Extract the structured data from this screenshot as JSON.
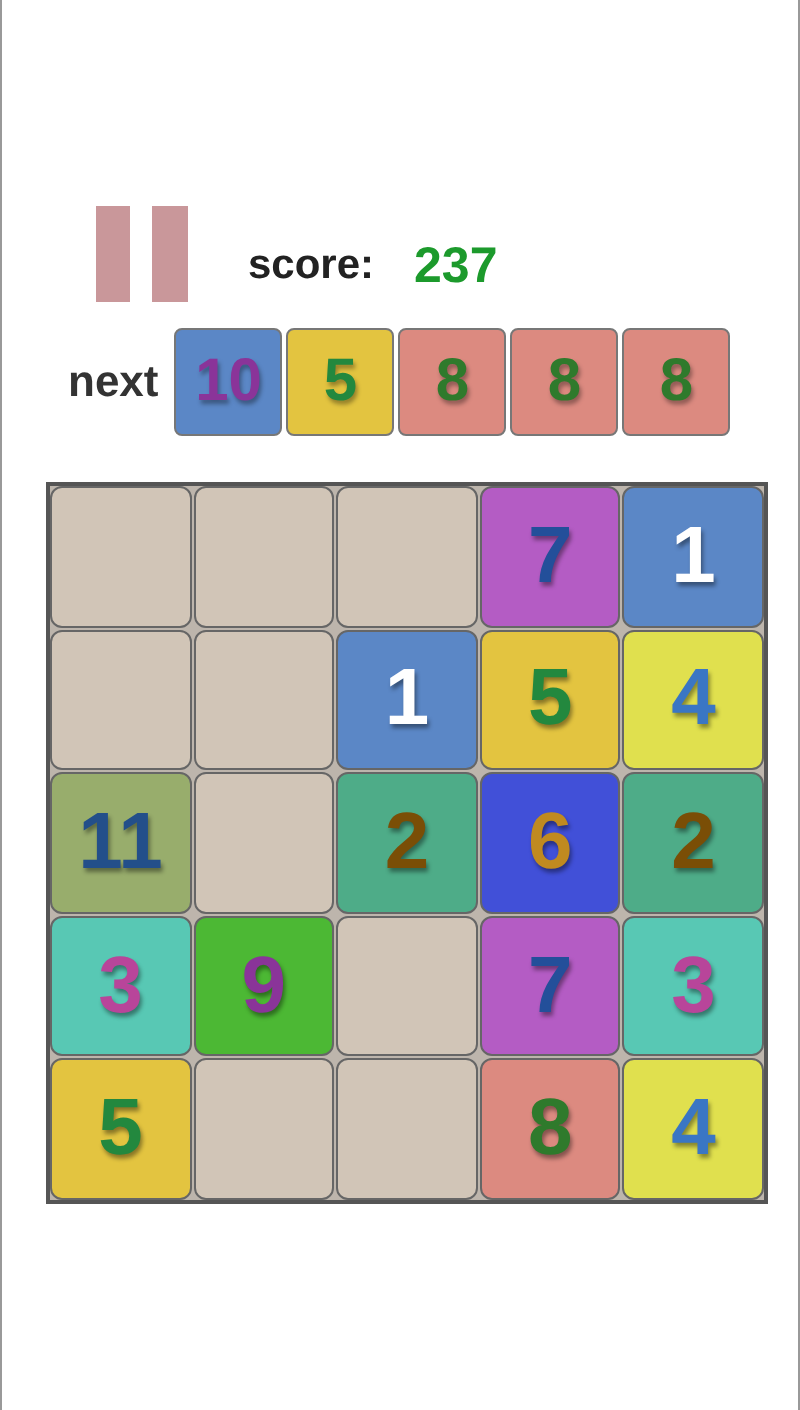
{
  "score": {
    "label": "score:",
    "value": "237"
  },
  "next": {
    "label": "next",
    "tiles": [
      {
        "value": "10",
        "color": "#5b87c6"
      },
      {
        "value": "5",
        "color": "#e3c440"
      },
      {
        "value": "8",
        "color": "#dc8a80"
      },
      {
        "value": "8",
        "color": "#dc8a80"
      },
      {
        "value": "8",
        "color": "#dc8a80"
      }
    ]
  },
  "board": {
    "rows": [
      [
        {
          "kind": "empty"
        },
        {
          "kind": "empty"
        },
        {
          "kind": "empty"
        },
        {
          "kind": "tile",
          "value": "7",
          "color": "#b45cc4"
        },
        {
          "kind": "tile",
          "value": "1",
          "color": "#5b87c6"
        }
      ],
      [
        {
          "kind": "empty"
        },
        {
          "kind": "empty"
        },
        {
          "kind": "tile",
          "value": "1",
          "color": "#5b87c6"
        },
        {
          "kind": "tile",
          "value": "5",
          "color": "#e3c440"
        },
        {
          "kind": "tile",
          "value": "4",
          "color": "#e0e04e"
        }
      ],
      [
        {
          "kind": "tile",
          "value": "11",
          "color": "#98ad6c"
        },
        {
          "kind": "empty"
        },
        {
          "kind": "tile",
          "value": "2",
          "color": "#4eac88"
        },
        {
          "kind": "tile",
          "value": "6",
          "color": "#4150d8"
        },
        {
          "kind": "tile",
          "value": "2",
          "color": "#4eac88"
        }
      ],
      [
        {
          "kind": "tile",
          "value": "3",
          "color": "#58c8b4"
        },
        {
          "kind": "tile",
          "value": "9",
          "color": "#4cb834"
        },
        {
          "kind": "empty"
        },
        {
          "kind": "tile",
          "value": "7",
          "color": "#b45cc4"
        },
        {
          "kind": "tile",
          "value": "3",
          "color": "#58c8b4"
        }
      ],
      [
        {
          "kind": "tile",
          "value": "5",
          "color": "#e3c440"
        },
        {
          "kind": "empty"
        },
        {
          "kind": "empty"
        },
        {
          "kind": "tile",
          "value": "8",
          "color": "#dc8a80"
        },
        {
          "kind": "tile",
          "value": "4",
          "color": "#e0e04e"
        }
      ]
    ]
  }
}
